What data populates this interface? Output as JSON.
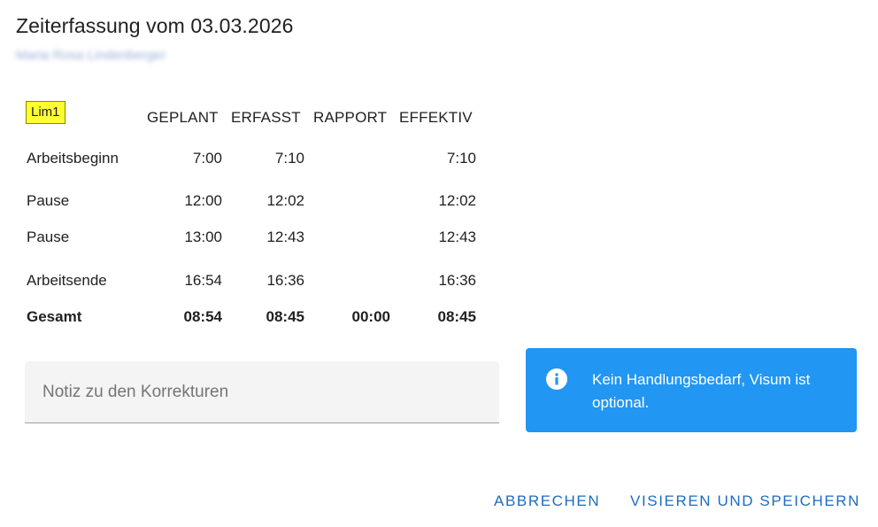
{
  "dialog": {
    "title": "Zeiterfassung vom 03.03.2026",
    "subtitle": "Maria Rosa Lindenberger"
  },
  "table": {
    "badge": "Lim1",
    "columns": [
      "GEPLANT",
      "ERFASST",
      "RAPPORT",
      "EFFEKTIV"
    ],
    "rows": [
      {
        "label": "Arbeitsbeginn",
        "values": [
          "7:00",
          "7:10",
          "",
          "7:10"
        ]
      },
      {
        "label": "Pause",
        "values": [
          "12:00",
          "12:02",
          "",
          "12:02"
        ]
      },
      {
        "label": "Pause",
        "values": [
          "13:00",
          "12:43",
          "",
          "12:43"
        ]
      },
      {
        "label": "Arbeitsende",
        "values": [
          "16:54",
          "16:36",
          "",
          "16:36"
        ]
      },
      {
        "label": "Gesamt",
        "values": [
          "08:54",
          "08:45",
          "00:00",
          "08:45"
        ]
      }
    ]
  },
  "note": {
    "placeholder": "Notiz zu den Korrekturen",
    "value": ""
  },
  "alert": {
    "icon": "info-icon",
    "color": "#2196f3",
    "message": "Kein Handlungsbedarf, Visum ist optional."
  },
  "actions": {
    "cancel": "ABBRECHEN",
    "save": "VISIEREN UND SPEICHERN",
    "color": "#1e6bc0"
  }
}
